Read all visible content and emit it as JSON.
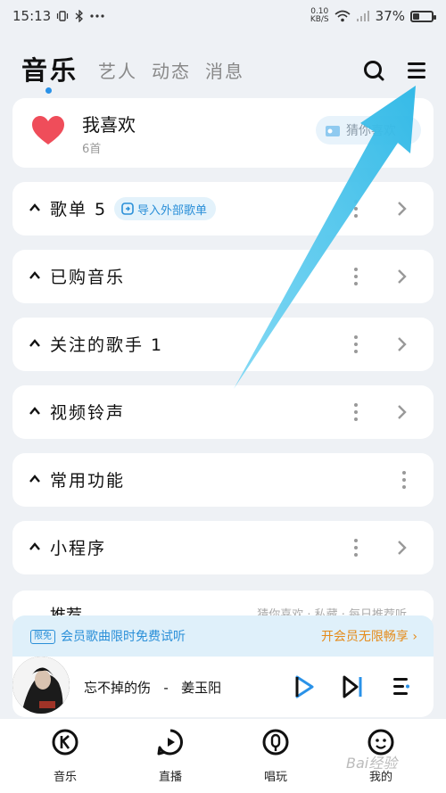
{
  "status": {
    "time": "15:13",
    "speed_value": "0.10",
    "speed_unit": "KB/S",
    "battery": "37%",
    "battery_level": 0.37
  },
  "tabs": [
    {
      "label": "音乐",
      "active": true
    },
    {
      "label": "艺人",
      "active": false
    },
    {
      "label": "动态",
      "active": false
    },
    {
      "label": "消息",
      "active": false
    }
  ],
  "favorites": {
    "title": "我喜欢",
    "count": "6首",
    "guess_label": "猜你喜欢"
  },
  "sections": [
    {
      "title": "歌单 5",
      "badge": "导入外部歌单",
      "has_more": true,
      "has_chevron": true
    },
    {
      "title": "已购音乐",
      "has_more": true,
      "has_chevron": true
    },
    {
      "title": "关注的歌手 1",
      "has_more": true,
      "has_chevron": true
    },
    {
      "title": "视频铃声",
      "has_more": true,
      "has_chevron": true
    },
    {
      "title": "常用功能",
      "has_more": true,
      "has_chevron": false
    },
    {
      "title": "小程序",
      "has_more": true,
      "has_chevron": true
    }
  ],
  "recommend_peek": {
    "title": "推荐",
    "right_text": "猜你喜欢 · 私藏 · 每日推荐听"
  },
  "vip": {
    "tag": "限免",
    "text": "会员歌曲限时免费试听",
    "cta": "开会员无限畅享 ›"
  },
  "player": {
    "song": "忘不掉的伤",
    "separator": "-",
    "artist": "姜玉阳"
  },
  "bottom_nav": [
    {
      "label": "音乐"
    },
    {
      "label": "直播"
    },
    {
      "label": "唱玩"
    },
    {
      "label": "我的"
    }
  ],
  "watermark": "Bai经验",
  "colors": {
    "accent": "#2a92e8",
    "arrow": "#39bfe8",
    "heart": "#ef4d5a",
    "vip_orange": "#e58b1a"
  }
}
